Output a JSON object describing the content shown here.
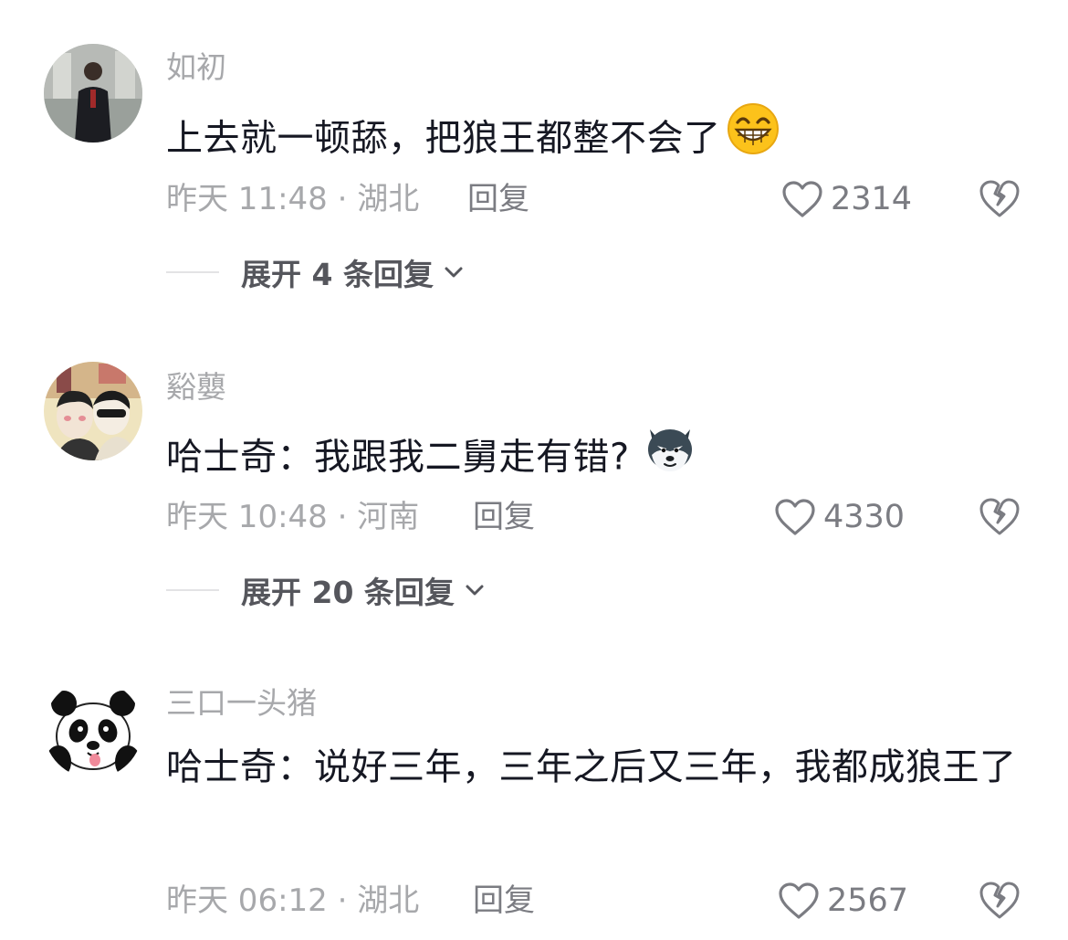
{
  "comments": [
    {
      "username": "如初",
      "text": "上去就一顿舔，把狼王都整不会了",
      "emoji": "grin-emoji",
      "time_location": "昨天 11:48 · 湖北",
      "reply_label": "回复",
      "likes": "2314",
      "expand_label": "展开 4 条回复"
    },
    {
      "username": "谿蘡",
      "text": "哈士奇：我跟我二舅走有错?",
      "emoji": "husky-emoji",
      "time_location": "昨天 10:48 · 河南",
      "reply_label": "回复",
      "likes": "4330",
      "expand_label": "展开 20 条回复"
    },
    {
      "username": "三口一头猪",
      "text": "哈士奇：说好三年，三年之后又三年，我都成狼王了",
      "time_location": "昨天 06:12 · 湖北",
      "reply_label": "回复",
      "likes": "2567"
    }
  ],
  "icons": {
    "like": "heart-outline-icon",
    "dislike": "broken-heart-icon",
    "expand": "chevron-down-icon"
  },
  "colors": {
    "primary_text": "#161823",
    "secondary_text": "#a7a8ab",
    "action_text": "#7b7c82"
  }
}
